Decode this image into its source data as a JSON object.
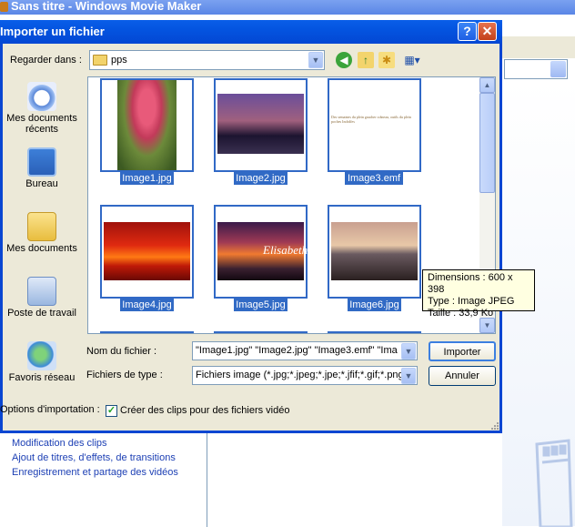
{
  "background_window": {
    "title": "Sans titre - Windows Movie Maker",
    "task_links": [
      "Modification des clips",
      "Ajout de titres, d'effets, de transitions",
      "Enregistrement et partage des vidéos"
    ]
  },
  "dialog": {
    "title": "Importer un fichier",
    "help_label": "?",
    "close_label": "✕",
    "look_in_label": "Regarder dans :",
    "look_in_value": "pps",
    "places": [
      {
        "label": "Mes documents récents",
        "icon": "recent-documents-icon"
      },
      {
        "label": "Bureau",
        "icon": "desktop-icon"
      },
      {
        "label": "Mes documents",
        "icon": "my-documents-icon"
      },
      {
        "label": "Poste de travail",
        "icon": "my-computer-icon"
      },
      {
        "label": "Favoris réseau",
        "icon": "network-places-icon"
      }
    ],
    "files": [
      {
        "name": "Image1.jpg",
        "thumb": "pink-tulip"
      },
      {
        "name": "Image2.jpg",
        "thumb": "city-skyline-dusk"
      },
      {
        "name": "Image3.emf",
        "thumb": "text-document"
      },
      {
        "name": "Image4.jpg",
        "thumb": "red-sunset"
      },
      {
        "name": "Image5.jpg",
        "thumb": "sunset-signature"
      },
      {
        "name": "Image6.jpg",
        "thumb": "palm-beach"
      }
    ],
    "image3_preview_text": "Des semaines du plein gaucher crâneau, outils du plein poches Inchdfes",
    "image5_overlay_text": "Elisabeth",
    "tooltip": {
      "dimensions": "Dimensions : 600 x 398",
      "type": "Type : Image JPEG",
      "size": "Taille  : 33,9 Ko"
    },
    "filename_label": "Nom du fichier :",
    "filename_value": "\"Image1.jpg\" \"Image2.jpg\" \"Image3.emf\" \"Ima",
    "filetype_label": "Fichiers de type :",
    "filetype_value": "Fichiers image (*.jpg;*.jpeg;*.jpe;*.jfif;*.gif;*.png;*",
    "import_button": "Importer",
    "cancel_button": "Annuler",
    "options_label": "Options d'importation :",
    "checkbox_label": "Créer des clips pour des fichiers vidéo",
    "checkbox_checked": true
  },
  "colors": {
    "titlebar": "#0347d3",
    "selection": "#316ac5",
    "dialog_bg": "#ece9d8",
    "link": "#1c3fb4"
  }
}
